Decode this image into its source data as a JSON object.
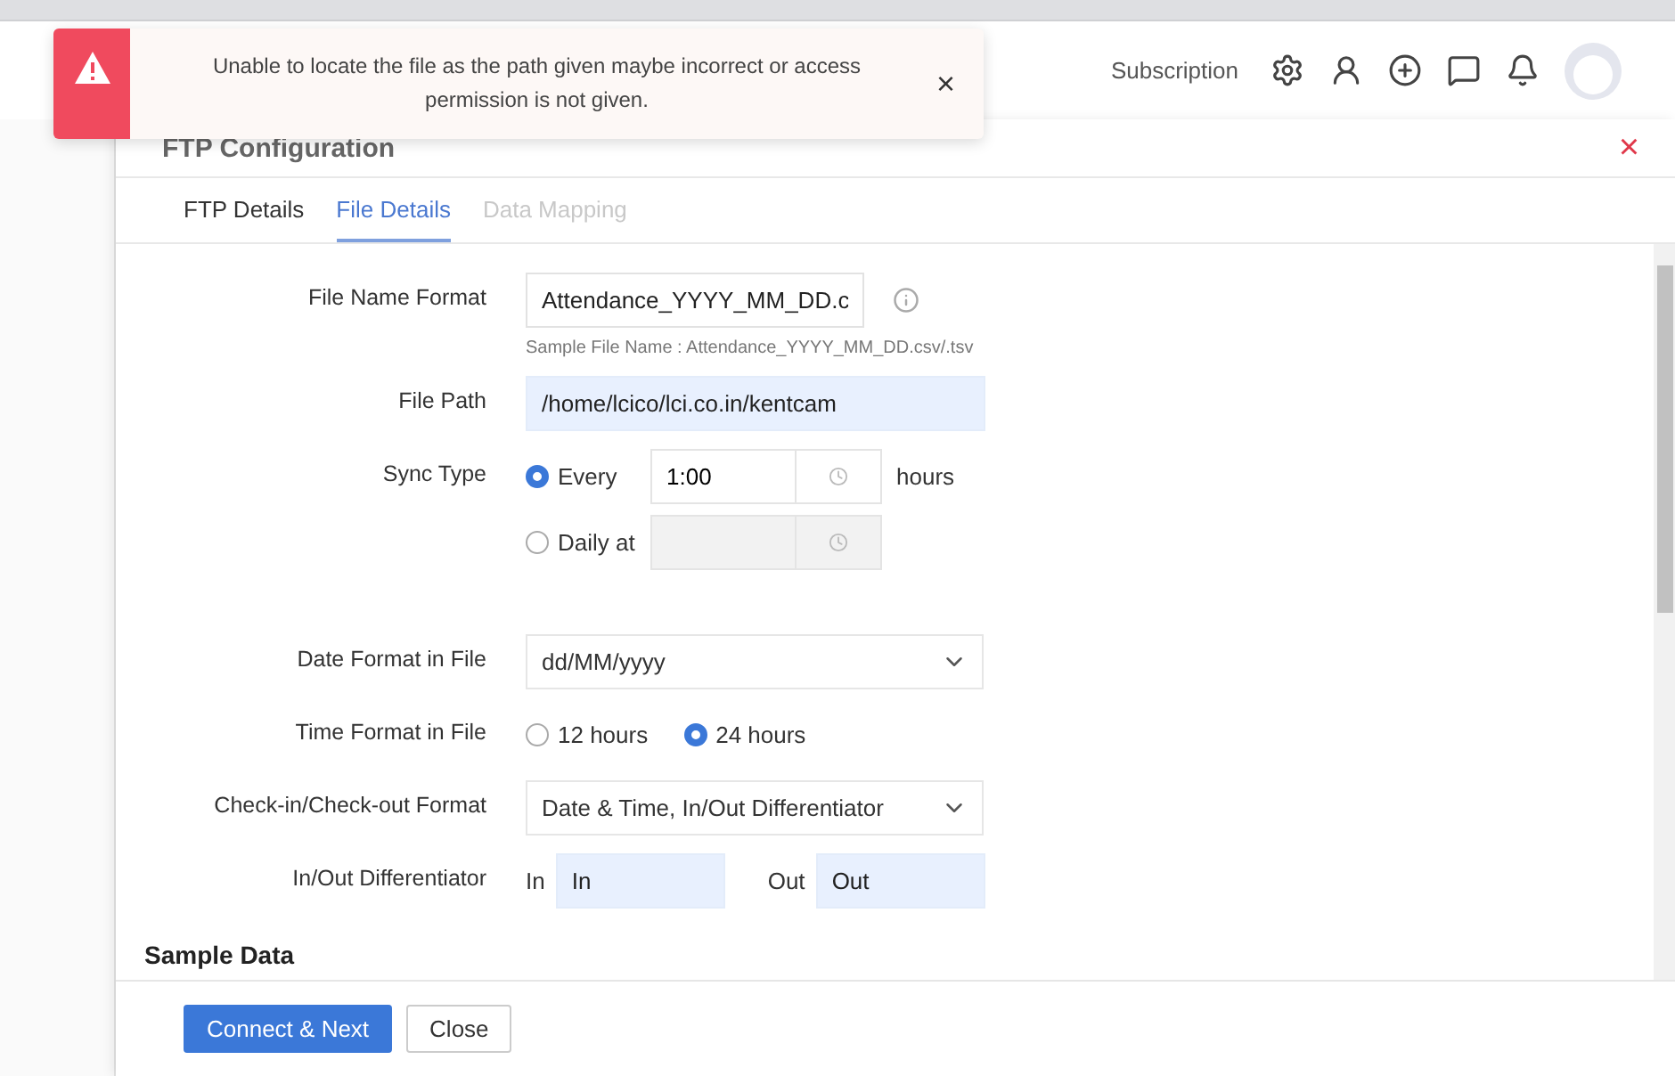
{
  "header": {
    "subscription": "Subscription"
  },
  "toast": {
    "message": "Unable to locate the file as the path given maybe incorrect or access permission is not given.",
    "close": "×"
  },
  "dialog": {
    "title": "FTP Configuration",
    "close": "×",
    "tabs": [
      {
        "label": "FTP Details",
        "selected": false,
        "disabled": false
      },
      {
        "label": "File Details",
        "selected": true,
        "disabled": false
      },
      {
        "label": "Data Mapping",
        "selected": false,
        "disabled": true
      }
    ],
    "fields": [
      {
        "kind": "text",
        "label": "File Name Format",
        "value": "Attendance_YYYY_MM_DD.c",
        "highlighted": false,
        "hint": "Sample File Name : Attendance_YYYY_MM_DD.csv/.tsv"
      },
      {
        "kind": "text",
        "label": "File Path",
        "value": "/home/lcico/lci.co.in/kentcam",
        "highlighted": true
      },
      {
        "kind": "sync",
        "label": "Sync Type",
        "options": [
          {
            "label": "Every",
            "value": "1:00",
            "unit": "hours",
            "selected": true
          },
          {
            "label": "Daily at",
            "selected": false
          }
        ]
      },
      {
        "kind": "select",
        "label": "Date Format in File",
        "value": "dd/MM/yyyy"
      },
      {
        "kind": "radio",
        "label": "Time Format in File",
        "options": [
          {
            "label": "12 hours",
            "selected": false
          },
          {
            "label": "24 hours",
            "selected": true
          }
        ]
      },
      {
        "kind": "select",
        "label": "Check-in/Check-out Format",
        "value": "Date & Time, In/Out Differentiator"
      },
      {
        "kind": "pair",
        "label": "In/Out Differentiator",
        "items": [
          {
            "label": "In",
            "value": "In",
            "highlighted": true
          },
          {
            "label": "Out",
            "value": "Out",
            "highlighted": true
          }
        ]
      }
    ],
    "section": "Sample Data",
    "buttons": [
      {
        "label": "Connect & Next",
        "primary": true
      },
      {
        "label": "Close",
        "primary": false
      }
    ]
  }
}
